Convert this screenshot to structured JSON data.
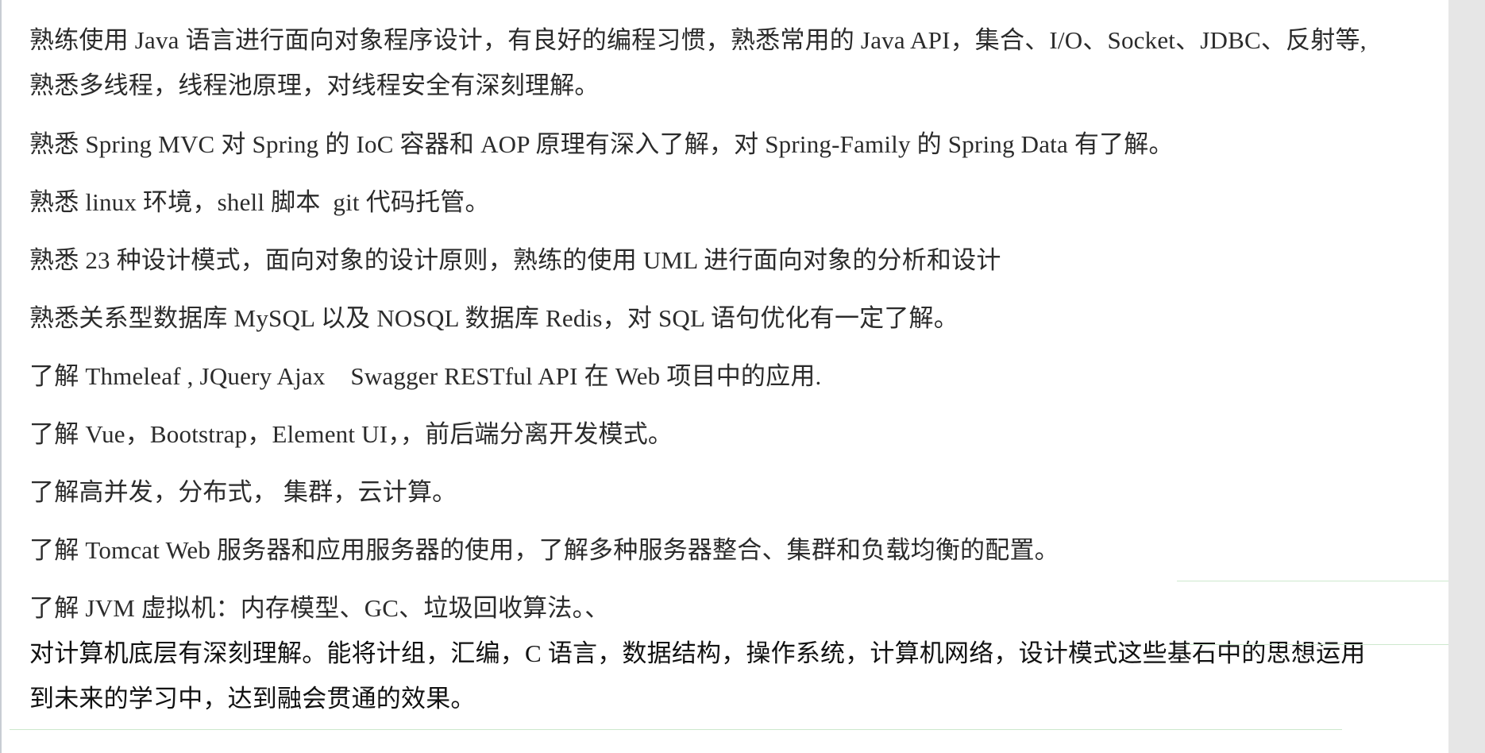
{
  "paragraphs": [
    "熟练使用 Java 语言进行面向对象程序设计，有良好的编程习惯，熟悉常用的 Java API，集合、I/O、Socket、JDBC、反射等, 熟悉多线程，线程池原理，对线程安全有深刻理解。",
    "熟悉 Spring MVC 对 Spring 的 IoC 容器和 AOP 原理有深入了解，对 Spring-Family 的 Spring Data 有了解。",
    "熟悉 linux 环境，shell 脚本  git 代码托管。",
    "熟悉 23 种设计模式，面向对象的设计原则，熟练的使用 UML 进行面向对象的分析和设计",
    "熟悉关系型数据库 MySQL 以及 NOSQL 数据库 Redis，对 SQL 语句优化有一定了解。",
    "了解 Thmeleaf , JQuery Ajax    Swagger RESTful API 在 Web 项目中的应用.",
    "了解 Vue，Bootstrap，Element UI，，前后端分离开发模式。",
    "了解高并发，分布式， 集群，云计算。",
    "了解 Tomcat Web 服务器和应用服务器的使用，了解多种服务器整合、集群和负载均衡的配置。",
    "了解 JVM 虚拟机：内存模型、GC、垃圾回收算法。、"
  ],
  "final_paragraph": "对计算机底层有深刻理解。能将计组，汇编，C 语言，数据结构，操作系统，计算机网络，设计模式这些基石中的思想运用到未来的学习中，达到融会贯通的效果。"
}
